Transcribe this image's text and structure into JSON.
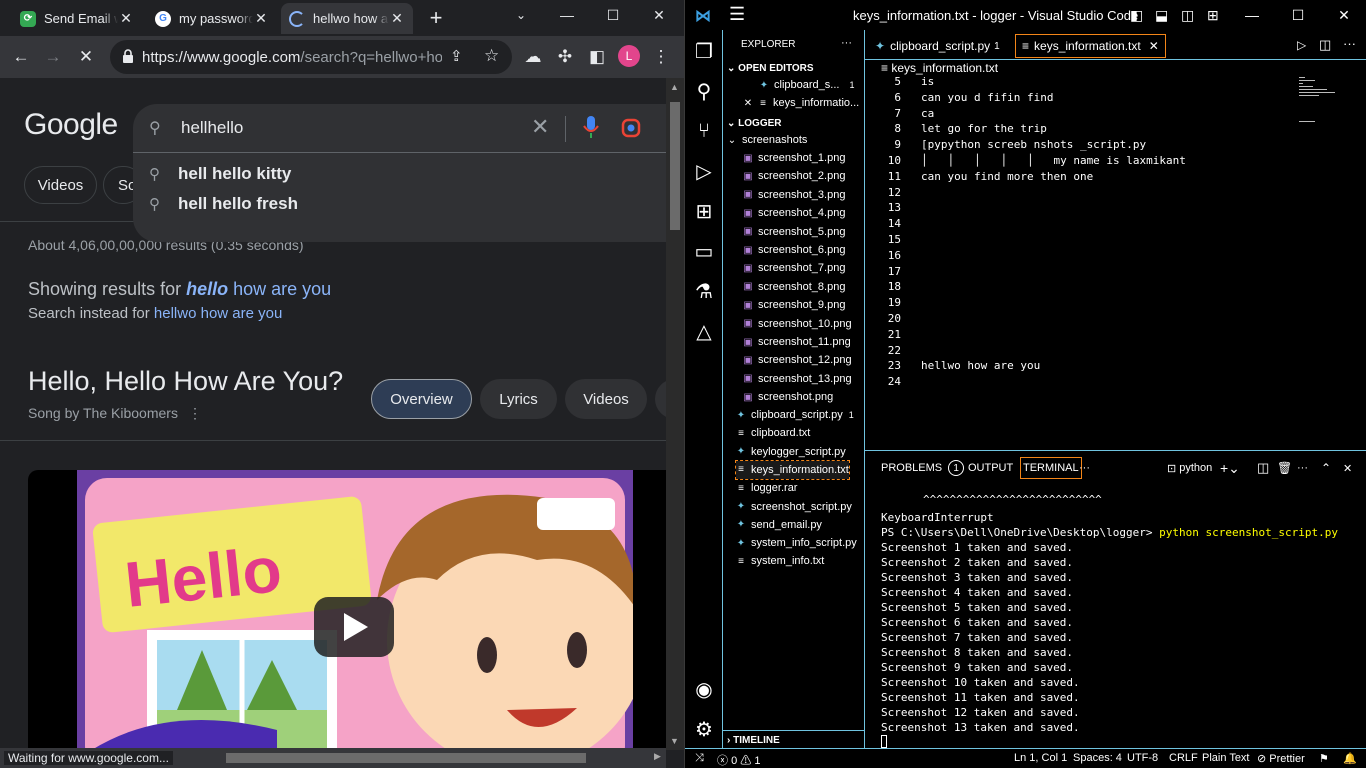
{
  "chrome": {
    "tabs": [
      {
        "title": "Send Email w",
        "close": "✕"
      },
      {
        "title": "my password",
        "close": "✕"
      },
      {
        "title": "hellwo how a",
        "close": "✕"
      }
    ],
    "new_tab": "+",
    "url_main": "https://www.google.com",
    "url_rest": "/search?q=hellwo+ho...",
    "profile_initial": "L",
    "google_logo": "Google",
    "query": "hellhello",
    "suggestions": [
      "hell hello kitty",
      "hell hello fresh"
    ],
    "filter_chips": [
      "Videos",
      "So"
    ],
    "result_stats": "About 4,06,00,00,000 results (0.35 seconds)",
    "showing_prefix": "Showing results for ",
    "showing_bold": "hello",
    "showing_rest": " how are you",
    "instead_prefix": "Search instead for ",
    "instead_link": "hellwo how are you",
    "knowledge_title": "Hello, Hello How Are You?",
    "knowledge_sub": "Song by The Kiboomers",
    "knowledge_chips": [
      "Overview",
      "Lyrics",
      "Videos"
    ],
    "video_text": "Hello",
    "status_text": "Waiting for www.google.com..."
  },
  "vscode": {
    "title": "keys_information.txt - logger - Visual Studio Code",
    "explorer_label": "EXPLORER",
    "open_editors_label": "OPEN EDITORS",
    "open_editors": [
      {
        "name": "clipboard_s...",
        "badge": "1"
      },
      {
        "name": "keys_informatio..."
      }
    ],
    "folder_label": "LOGGER",
    "subfolder": "screenashots",
    "screenshots": [
      "screenshot_1.png",
      "screenshot_2.png",
      "screenshot_3.png",
      "screenshot_4.png",
      "screenshot_5.png",
      "screenshot_6.png",
      "screenshot_7.png",
      "screenshot_8.png",
      "screenshot_9.png",
      "screenshot_10.png",
      "screenshot_11.png",
      "screenshot_12.png",
      "screenshot_13.png",
      "screenshot.png"
    ],
    "files": [
      {
        "name": "clipboard_script.py",
        "badge": "1",
        "type": "py"
      },
      {
        "name": "clipboard.txt",
        "type": "txt"
      },
      {
        "name": "keylogger_script.py",
        "type": "py"
      },
      {
        "name": "keys_information.txt",
        "type": "txt"
      },
      {
        "name": "logger.rar",
        "type": "txt"
      },
      {
        "name": "screenshot_script.py",
        "type": "py"
      },
      {
        "name": "send_email.py",
        "type": "py"
      },
      {
        "name": "system_info_script.py",
        "type": "py"
      },
      {
        "name": "system_info.txt",
        "type": "txt"
      }
    ],
    "timeline_label": "TIMELINE",
    "editor_tabs": [
      {
        "name": "clipboard_script.py",
        "badge": "1"
      },
      {
        "name": "keys_information.txt",
        "close": "✕"
      }
    ],
    "breadcrumb": "keys_information.txt",
    "lines": [
      {
        "n": "5",
        "text": "is"
      },
      {
        "n": "6",
        "text": "can you d fifin find"
      },
      {
        "n": "7",
        "text": "ca"
      },
      {
        "n": "8",
        "text": "let go for the trip"
      },
      {
        "n": "9",
        "text": "[pypython screeb nshots _script.py"
      },
      {
        "n": "10",
        "text": "│   │   │   │   │   my name is laxmikant"
      },
      {
        "n": "11",
        "text": "can you find more then one"
      },
      {
        "n": "12",
        "text": ""
      },
      {
        "n": "13",
        "text": ""
      },
      {
        "n": "14",
        "text": ""
      },
      {
        "n": "15",
        "text": ""
      },
      {
        "n": "16",
        "text": ""
      },
      {
        "n": "17",
        "text": ""
      },
      {
        "n": "18",
        "text": ""
      },
      {
        "n": "19",
        "text": ""
      },
      {
        "n": "20",
        "text": ""
      },
      {
        "n": "21",
        "text": ""
      },
      {
        "n": "22",
        "text": ""
      },
      {
        "n": "23",
        "text": "hellwo how are you"
      },
      {
        "n": "24",
        "text": ""
      }
    ],
    "panel_tabs": {
      "problems": "PROBLEMS",
      "problems_badge": "1",
      "output": "OUTPUT",
      "terminal": "TERMINAL",
      "more": "···"
    },
    "terminal_shell": "python",
    "terminal": {
      "carets": "^^^^^^^^^^^^^^^^^^^^^^^^^^^",
      "interrupt": "KeyboardInterrupt",
      "prompt": "PS C:\\Users\\Dell\\OneDrive\\Desktop\\logger> ",
      "command": "python screenshot_script.py",
      "output": [
        "Screenshot 1 taken and saved.",
        "Screenshot 2 taken and saved.",
        "Screenshot 3 taken and saved.",
        "Screenshot 4 taken and saved.",
        "Screenshot 5 taken and saved.",
        "Screenshot 6 taken and saved.",
        "Screenshot 7 taken and saved.",
        "Screenshot 8 taken and saved.",
        "Screenshot 9 taken and saved.",
        "Screenshot 10 taken and saved.",
        "Screenshot 11 taken and saved.",
        "Screenshot 12 taken and saved.",
        "Screenshot 13 taken and saved."
      ]
    },
    "status": {
      "errors": "0",
      "warnings": "1",
      "position": "Ln 1, Col 1",
      "spaces": "Spaces: 4",
      "encoding": "UTF-8",
      "eol": "CRLF",
      "language": "Plain Text",
      "prettier": "Prettier"
    }
  }
}
